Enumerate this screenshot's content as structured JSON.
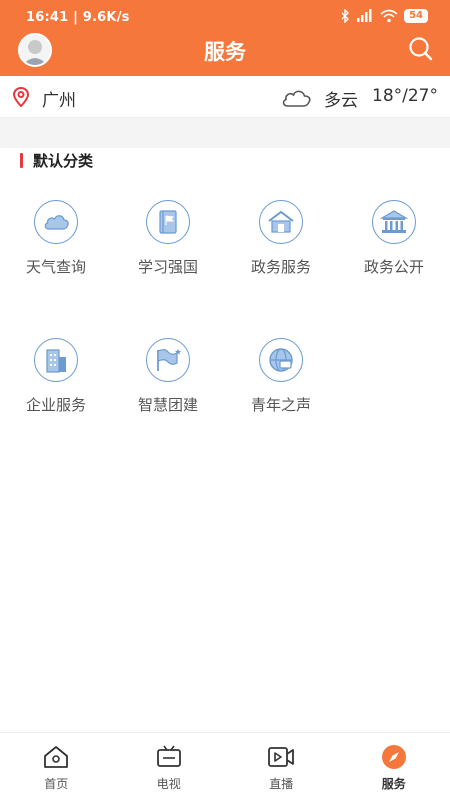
{
  "status_bar": {
    "time": "16:41",
    "speed": "9.6K/s",
    "battery": "54"
  },
  "header": {
    "title": "服务"
  },
  "weather": {
    "city": "广州",
    "condition": "多云",
    "temperature": "18°/27°"
  },
  "section": {
    "title": "默认分类"
  },
  "services": [
    {
      "label": "天气查询",
      "icon": "cloud-icon"
    },
    {
      "label": "学习强国",
      "icon": "book-flag-icon"
    },
    {
      "label": "政务服务",
      "icon": "house-icon"
    },
    {
      "label": "政务公开",
      "icon": "government-building-icon"
    },
    {
      "label": "企业服务",
      "icon": "office-building-icon"
    },
    {
      "label": "智慧团建",
      "icon": "flag-icon"
    },
    {
      "label": "青年之声",
      "icon": "globe-icon"
    }
  ],
  "tabbar": {
    "items": [
      {
        "label": "首页",
        "icon": "home-icon"
      },
      {
        "label": "电视",
        "icon": "tv-icon"
      },
      {
        "label": "直播",
        "icon": "live-video-icon"
      },
      {
        "label": "服务",
        "icon": "compass-icon",
        "active": true
      }
    ]
  },
  "colors": {
    "brand": "#f5773b",
    "accent_bar": "#e8383d",
    "icon_blue": "#6b9bd2"
  }
}
